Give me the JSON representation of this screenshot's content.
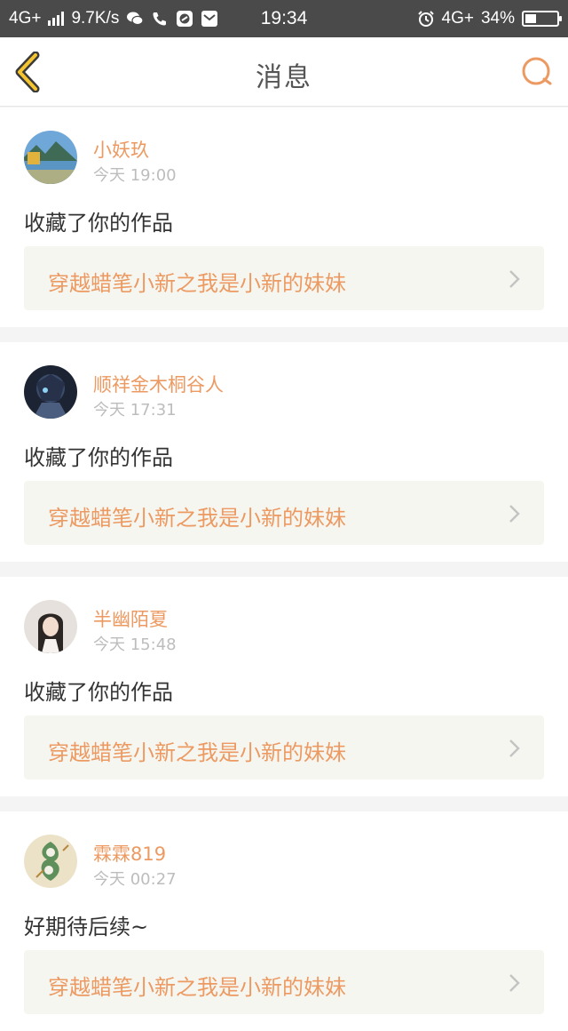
{
  "status_bar": {
    "network_left": "4G+",
    "speed": "9.7K/s",
    "time": "19:34",
    "network_right": "4G+",
    "battery": "34%",
    "battery_level": 0.34
  },
  "header": {
    "title": "消息",
    "back_icon": "chevron-left-icon",
    "search_icon": "search-icon",
    "accent": "#ec9a62"
  },
  "messages": [
    {
      "user": "小妖玖",
      "time": "今天 19:00",
      "text": "收藏了你的作品",
      "work": "穿越蜡笔小新之我是小新的妹妹"
    },
    {
      "user": "顺祥金木桐谷人",
      "time": "今天 17:31",
      "text": "收藏了你的作品",
      "work": "穿越蜡笔小新之我是小新的妹妹"
    },
    {
      "user": "半幽陌夏",
      "time": "今天 15:48",
      "text": "收藏了你的作品",
      "work": "穿越蜡笔小新之我是小新的妹妹"
    },
    {
      "user": "霖霖819",
      "time": "今天 00:27",
      "text": "好期待后续~",
      "work": "穿越蜡笔小新之我是小新的妹妹"
    }
  ]
}
